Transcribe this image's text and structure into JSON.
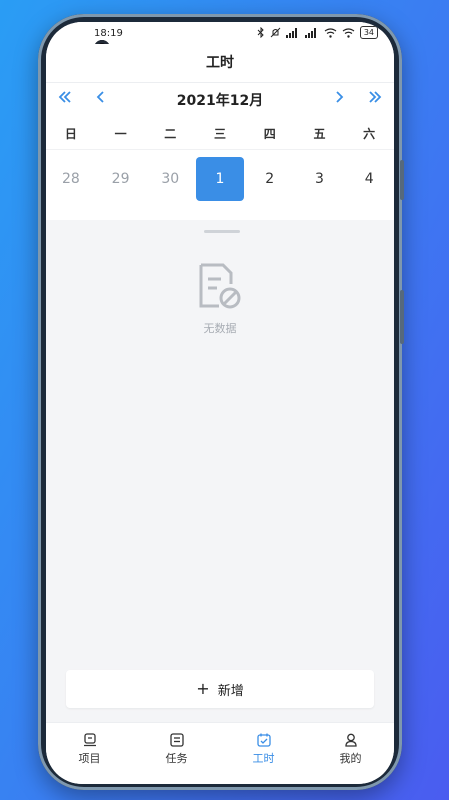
{
  "status_bar": {
    "time": "18:19",
    "battery": "34"
  },
  "nav": {
    "title": "工时"
  },
  "calendar": {
    "month_label": "2021年12月",
    "weekdays": [
      "日",
      "一",
      "二",
      "三",
      "四",
      "五",
      "六"
    ],
    "days": [
      {
        "label": "28",
        "state": "prev"
      },
      {
        "label": "29",
        "state": "prev"
      },
      {
        "label": "30",
        "state": "prev"
      },
      {
        "label": "1",
        "state": "selected"
      },
      {
        "label": "2",
        "state": "current"
      },
      {
        "label": "3",
        "state": "current"
      },
      {
        "label": "4",
        "state": "current"
      }
    ]
  },
  "empty_state": {
    "text": "无数据",
    "icon": "no-data-icon"
  },
  "actions": {
    "add_label": "新增"
  },
  "tabs": [
    {
      "label": "项目",
      "icon": "project-icon"
    },
    {
      "label": "任务",
      "icon": "task-icon"
    },
    {
      "label": "工时",
      "icon": "timesheet-icon",
      "active": true
    },
    {
      "label": "我的",
      "icon": "profile-icon"
    }
  ],
  "colors": {
    "accent": "#3a8ee6",
    "background": "#f4f5f7"
  }
}
